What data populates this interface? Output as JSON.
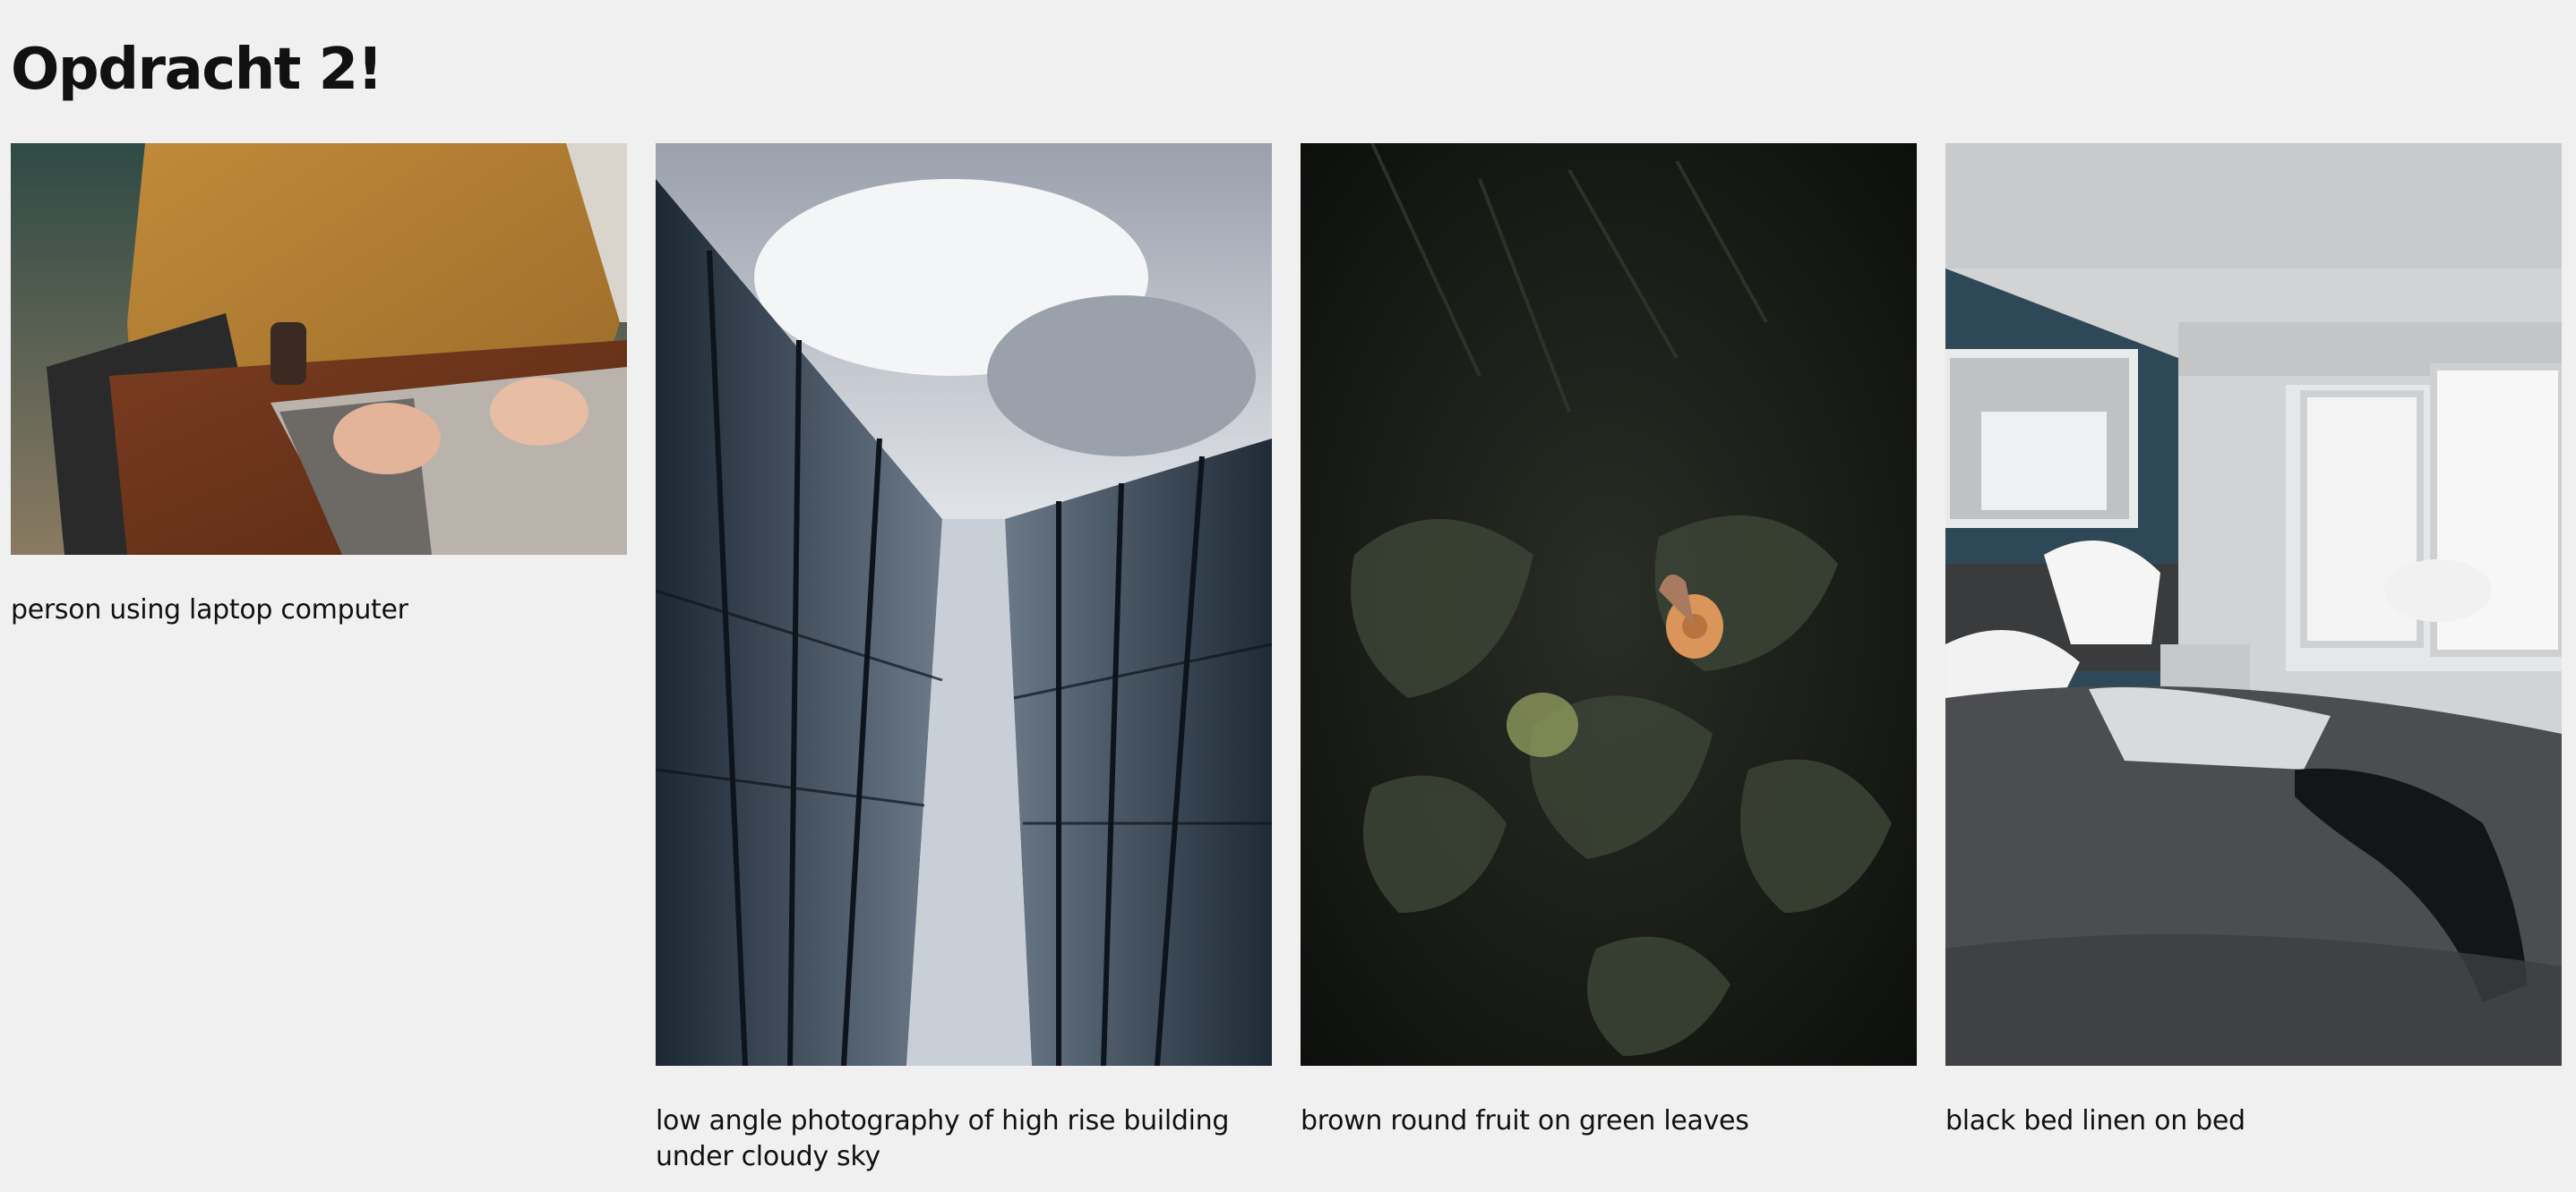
{
  "page": {
    "title": "Opdracht 2!"
  },
  "gallery": {
    "items": [
      {
        "image_subject": "person-laptop-image",
        "alt": "person using laptop computer",
        "caption": "person using laptop computer"
      },
      {
        "image_subject": "high-rise-building-image",
        "alt": "low angle photography of high rise building under cloudy sky",
        "caption": "low angle photography of high rise building under cloudy sky"
      },
      {
        "image_subject": "snail-leaves-image",
        "alt": "brown round fruit on green leaves",
        "caption": "brown round fruit on green leaves"
      },
      {
        "image_subject": "bedroom-image",
        "alt": "black bed linen on bed",
        "caption": "black bed linen on bed"
      }
    ]
  },
  "colors": {
    "background": "#f0f0f0",
    "text": "#111111"
  }
}
